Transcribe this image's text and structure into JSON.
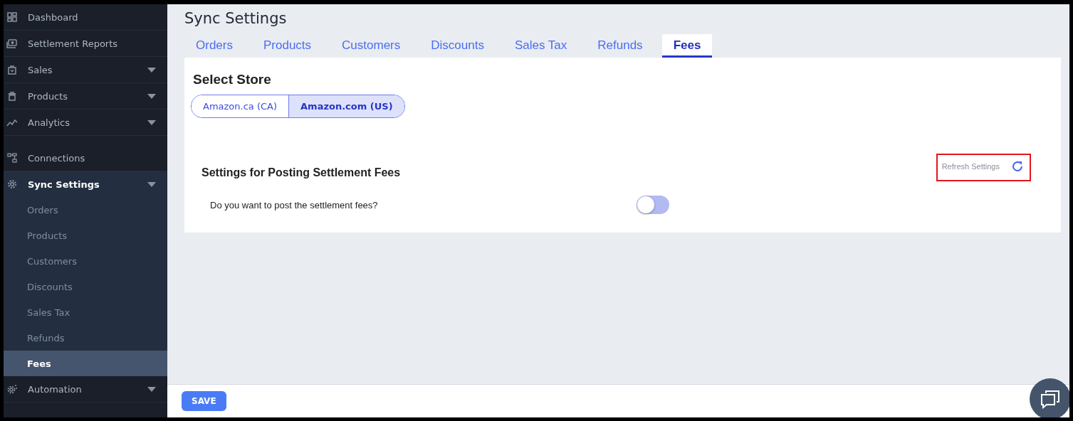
{
  "sidebar": {
    "sections": [
      {
        "items": [
          {
            "label": "Dashboard",
            "dropdown": false,
            "selected": false
          },
          {
            "label": "Settlement Reports",
            "dropdown": false,
            "selected": false
          },
          {
            "label": "Sales",
            "dropdown": true,
            "selected": false
          },
          {
            "label": "Products",
            "dropdown": true,
            "selected": false
          },
          {
            "label": "Analytics",
            "dropdown": true,
            "selected": false
          }
        ]
      },
      {
        "items": [
          {
            "label": "Connections",
            "dropdown": false,
            "selected": false
          },
          {
            "label": "Sync Settings",
            "dropdown": true,
            "selected": true,
            "children": [
              {
                "label": "Orders",
                "selected": false
              },
              {
                "label": "Products",
                "selected": false
              },
              {
                "label": "Customers",
                "selected": false
              },
              {
                "label": "Discounts",
                "selected": false
              },
              {
                "label": "Sales Tax",
                "selected": false
              },
              {
                "label": "Refunds",
                "selected": false
              },
              {
                "label": "Fees",
                "selected": true
              }
            ]
          },
          {
            "label": "Automation",
            "dropdown": true,
            "selected": false
          }
        ]
      }
    ]
  },
  "page": {
    "title": "Sync Settings"
  },
  "tabs": [
    {
      "label": "Orders",
      "selected": false
    },
    {
      "label": "Products",
      "selected": false
    },
    {
      "label": "Customers",
      "selected": false
    },
    {
      "label": "Discounts",
      "selected": false
    },
    {
      "label": "Sales Tax",
      "selected": false
    },
    {
      "label": "Refunds",
      "selected": false
    },
    {
      "label": "Fees",
      "selected": true
    }
  ],
  "store": {
    "heading": "Select Store",
    "options": [
      {
        "label": "Amazon.ca (CA)",
        "selected": false
      },
      {
        "label": "Amazon.com (US)",
        "selected": true
      }
    ]
  },
  "settings": {
    "heading": "Settings for Posting Settlement Fees",
    "refresh": "Refresh Settings",
    "rows": [
      {
        "label": "Do you want to post the settlement fees?",
        "on": false
      }
    ]
  },
  "footer": {
    "save": "SAVE"
  }
}
